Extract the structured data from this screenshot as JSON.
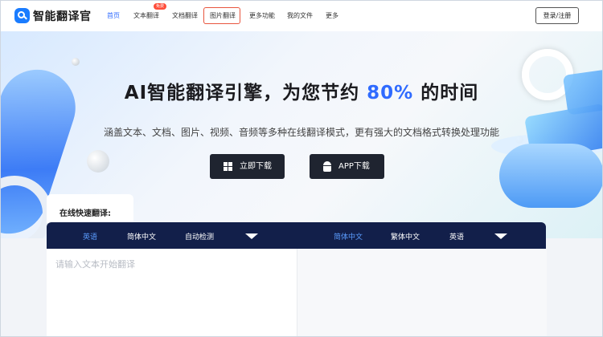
{
  "brand": {
    "name": "智能翻译官"
  },
  "nav": {
    "items": [
      {
        "label": "首页"
      },
      {
        "label": "文本翻译"
      },
      {
        "label": "文档翻译"
      },
      {
        "label": "图片翻译"
      },
      {
        "label": "更多功能"
      },
      {
        "label": "我的文件"
      },
      {
        "label": "更多"
      }
    ],
    "badge": "免费",
    "login": "登录/注册"
  },
  "hero": {
    "headline_pre": "AI智能翻译引擎，为您节约",
    "headline_highlight": "80%",
    "headline_post": "的时间",
    "subline": "涵盖文本、文档、图片、视频、音频等多种在线翻译模式，更有强大的文档格式转换处理功能",
    "download_button": "立即下载",
    "app_button": "APP下载"
  },
  "translator": {
    "title": "在线快速翻译:",
    "source_langs": [
      "英语",
      "简体中文",
      "自动检测"
    ],
    "target_langs": [
      "简体中文",
      "繁体中文",
      "英语"
    ],
    "placeholder": "请输入文本开始翻译"
  },
  "colors": {
    "accent": "#2f6bff",
    "lang_bar": "#121f4a",
    "download_btn": "#1f2430",
    "highlight_box": "#e8553e",
    "badge": "#ff4d3a"
  }
}
